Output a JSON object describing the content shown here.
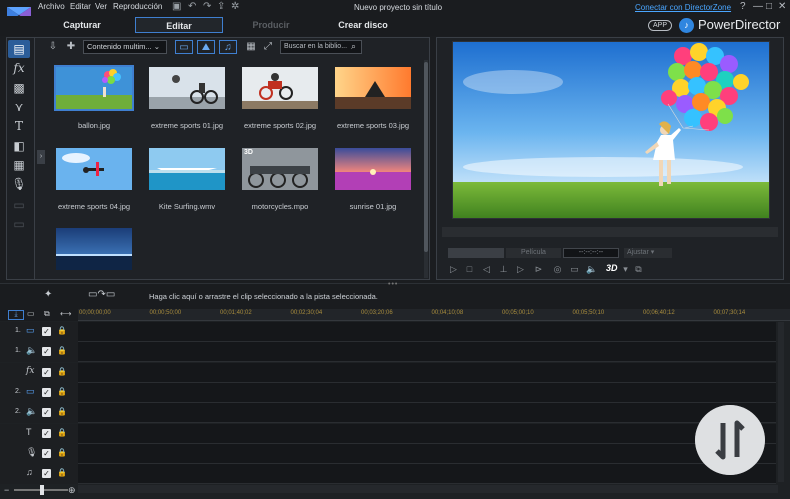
{
  "menu": {
    "items": [
      "Archivo",
      "Editar",
      "Ver",
      "Reproducción"
    ],
    "project_title": "Nuevo proyecto sin título",
    "directorzone_link": "Conectar con DirectorZone",
    "window_controls": {
      "help": "?",
      "minimize": "—",
      "maximize": "□",
      "close": "✕"
    }
  },
  "modes": {
    "capture": "Capturar",
    "edit": "Editar",
    "produce": "Producir",
    "disc": "Crear disco",
    "active": "edit"
  },
  "brand": {
    "app_badge": "APP",
    "name": "PowerDirector"
  },
  "library": {
    "content_filter": "Contenido multim... ⌄",
    "search_placeholder": "Buscar en la biblio...",
    "items": [
      {
        "label": "ballon.jpg",
        "selected": true
      },
      {
        "label": "extreme sports 01.jpg"
      },
      {
        "label": "extreme sports 02.jpg"
      },
      {
        "label": "extreme sports 03.jpg"
      },
      {
        "label": "extreme sports 04.jpg"
      },
      {
        "label": "Kite Surfing.wmv"
      },
      {
        "label": "motorcycles.mpo",
        "badge": "3D"
      },
      {
        "label": "sunrise 01.jpg"
      },
      {
        "label": ""
      }
    ]
  },
  "preview": {
    "mode_label": "Película",
    "timecode": "--:--:--:--",
    "fit_label": "Ajustar",
    "btn_3d": "3D"
  },
  "timeline": {
    "hint": "Haga clic aquí o arrastre el clip seleccionado a la pista seleccionada.",
    "ruler_labels": [
      "00;00;00;00",
      "00;00;50;00",
      "00;01;40;02",
      "00;02;30;04",
      "00;03;20;06",
      "00;04;10;08",
      "00;05;00;10",
      "00;05;50;10",
      "00;06;40;12",
      "00;07;30;14"
    ],
    "tracks": [
      {
        "num": "1.",
        "type": "video-track-icon",
        "glyph": "▭"
      },
      {
        "num": "1.",
        "type": "audio-track-icon",
        "glyph": "🔈"
      },
      {
        "num": "",
        "type": "fx-track-icon",
        "glyph": "fx"
      },
      {
        "num": "2.",
        "type": "video-track-icon",
        "glyph": "▭"
      },
      {
        "num": "2.",
        "type": "audio-track-icon",
        "glyph": "🔈"
      },
      {
        "num": "",
        "type": "title-track-icon",
        "glyph": "T"
      },
      {
        "num": "",
        "type": "voice-track-icon",
        "glyph": "🎙"
      },
      {
        "num": "",
        "type": "music-track-icon",
        "glyph": "♫"
      }
    ]
  },
  "colors": {
    "accent": "#3f7fd0",
    "link": "#4aa6ff",
    "ruler_text": "#a98d3d"
  }
}
